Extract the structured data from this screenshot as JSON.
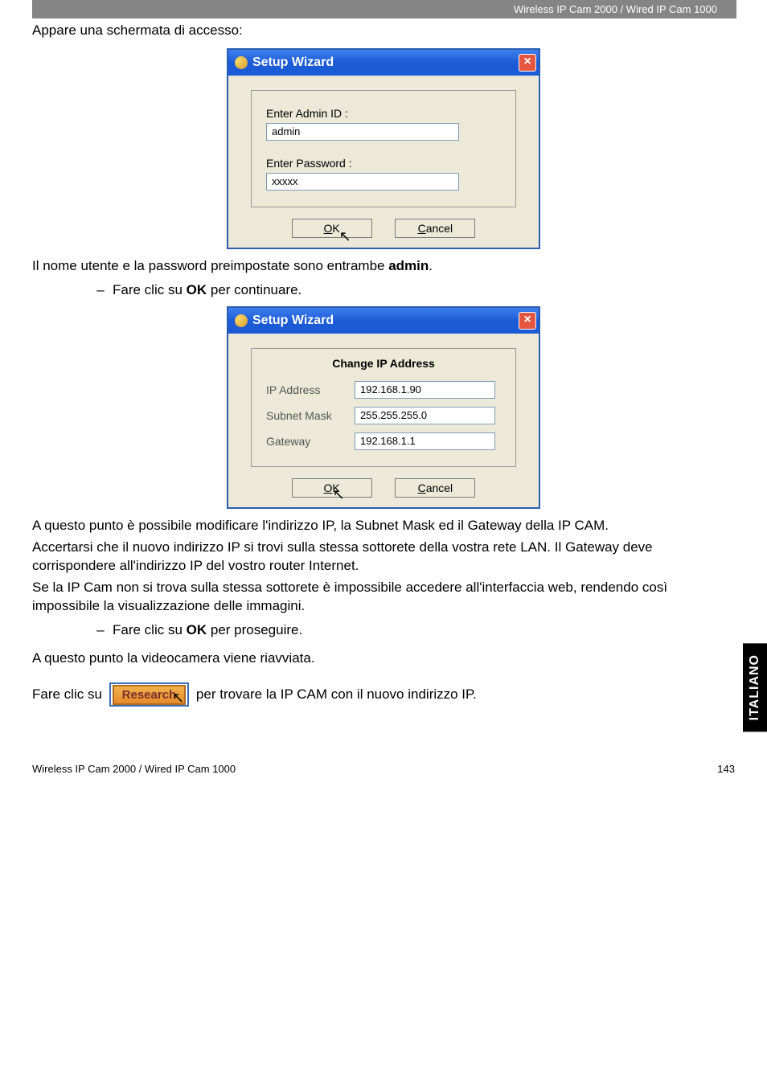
{
  "header": {
    "product_line": "Wireless IP Cam 2000 / Wired IP Cam 1000"
  },
  "intro": "Appare una schermata di accesso:",
  "dialog1": {
    "title": "Setup Wizard",
    "admin_id_label": "Enter Admin ID :",
    "admin_id_value": "admin",
    "password_label": "Enter Password :",
    "password_value": "xxxxx",
    "ok": "OK",
    "cancel": "Cancel"
  },
  "mid_text": {
    "line1a": "Il nome utente e la password preimpostate sono entrambe ",
    "line1b": "admin",
    "line1c": ".",
    "bullet1a": "Fare clic su ",
    "bullet1b": "OK",
    "bullet1c": " per continuare."
  },
  "dialog2": {
    "title": "Setup Wizard",
    "section_title": "Change IP Address",
    "ip_label": "IP Address",
    "ip_value": "192.168.1.90",
    "mask_label": "Subnet Mask",
    "mask_value": "255.255.255.0",
    "gw_label": "Gateway",
    "gw_value": "192.168.1.1",
    "ok": "OK",
    "cancel": "Cancel"
  },
  "para": {
    "p1": "A questo punto è possibile modificare l'indirizzo IP, la Subnet Mask ed il Gateway della IP CAM.",
    "p2": "Accertarsi che il nuovo indirizzo IP si trovi sulla stessa sottorete della vostra rete LAN. Il Gateway deve corrispondere all'indirizzo IP del vostro router Internet.",
    "p3": "Se la IP Cam non si trova sulla stessa sottorete è impossibile accedere all'interfaccia web, rendendo così impossibile la visualizzazione delle immagini.",
    "bullet2a": "Fare clic su ",
    "bullet2b": "OK",
    "bullet2c": " per proseguire.",
    "p4": "A questo punto la videocamera viene riavviata.",
    "p5a": "Fare clic su ",
    "p5b": " per trovare la IP CAM con il nuovo indirizzo IP."
  },
  "research_btn": "Research",
  "side_tab": "ITALIANO",
  "footer": {
    "left": "Wireless IP Cam 2000 / Wired IP Cam 1000",
    "right": "143"
  }
}
